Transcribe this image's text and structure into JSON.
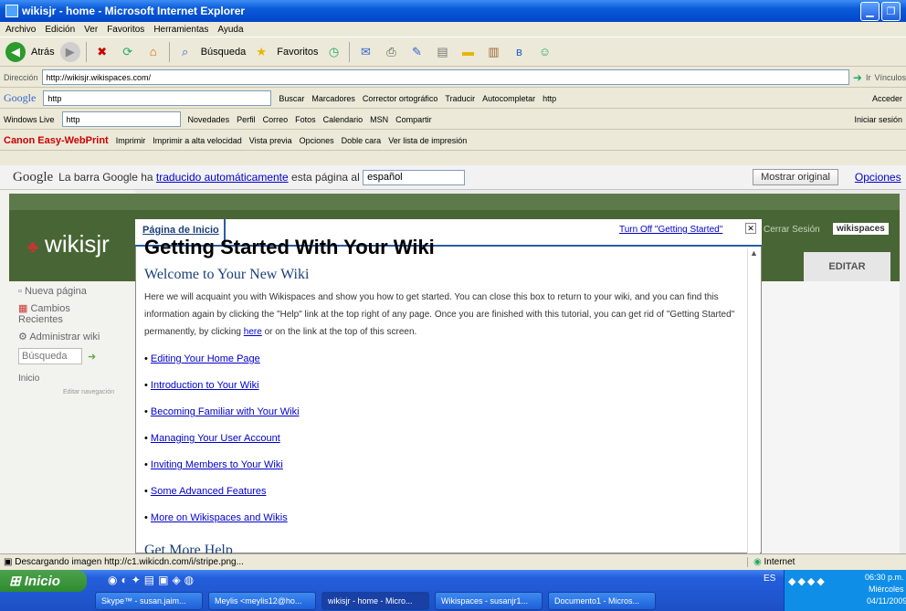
{
  "window": {
    "title": "wikisjr - home - Microsoft Internet Explorer"
  },
  "menu": [
    "Archivo",
    "Edición",
    "Ver",
    "Favoritos",
    "Herramientas",
    "Ayuda"
  ],
  "toolbar": {
    "back_label": "Atrás",
    "search_label": "Búsqueda",
    "favorites_label": "Favoritos"
  },
  "address": {
    "label": "Dirección",
    "url": "http://wikisjr.wikispaces.com/",
    "go_label": "Ir",
    "links_label": "Vínculos"
  },
  "google_toolbar": {
    "logo": "Google",
    "query": "http",
    "buscar": "Buscar",
    "marcadores": "Marcadores",
    "corrector": "Corrector ortográfico",
    "traducir": "Traducir",
    "autocompletar": "Autocompletar",
    "http": "http",
    "acceder": "Acceder"
  },
  "live_toolbar": {
    "brand": "Windows Live",
    "query": "http",
    "items": [
      "Novedades",
      "Perfil",
      "Correo",
      "Fotos",
      "Calendario",
      "MSN",
      "Compartir"
    ],
    "signin": "Iniciar sesión"
  },
  "canon_toolbar": {
    "brand": "Canon Easy-WebPrint",
    "items": [
      "Imprimir",
      "Imprimir a alta velocidad",
      "Vista previa",
      "Opciones",
      "Doble cara",
      "Ver lista de impresión"
    ]
  },
  "translate_bar": {
    "logo": "Google",
    "text_before": "La barra Google ha",
    "link": "traducido automáticamente",
    "text_after": "esta página al",
    "language": "español",
    "show_original": "Mostrar original",
    "options": "Opciones"
  },
  "site": {
    "name": "wikisjr",
    "logout": "Cerrar Sesión",
    "wikispaces": "wikispaces",
    "edit_tab": "EDITAR"
  },
  "sidebar": {
    "items": [
      "Nueva página",
      "Cambios Recientes",
      "Administrar wiki"
    ],
    "search_placeholder": "Búsqueda",
    "home": "Inicio",
    "edit_nav": "Editar navegación"
  },
  "modal": {
    "tab": "Página de Inicio",
    "turn_off": "Turn Off \"Getting Started\"",
    "title": "Getting Started With Your Wiki",
    "welcome": "Welcome to Your New Wiki",
    "intro_1": "Here we will acquaint you with Wikispaces and show you how to get started. You can close this box to return to your wiki, and you can find this information again by clicking the \"Help\" link at the top right of any page. Once you are finished with this tutorial, you can get rid of \"Getting Started\" permanently, by clicking",
    "intro_link": "here",
    "intro_2": "or on the link at the top of this screen.",
    "links": [
      "Editing Your Home Page",
      "Introduction to Your Wiki",
      "Becoming Familiar with Your Wiki",
      "Managing Your User Account",
      "Inviting Members to Your Wiki",
      "Some Advanced Features",
      "More on Wikispaces and Wikis"
    ],
    "more_help": "Get More Help"
  },
  "status": {
    "text": "Descargando imagen http://c1.wikicdn.com/i/stripe.png...",
    "zone": "Internet"
  },
  "taskbar": {
    "start": "Inicio",
    "tasks": [
      "Skype™ - susan.jaim...",
      "Meylis <meylis12@ho...",
      "wikisjr - home - Micro...",
      "Wikispaces - susanjr1...",
      "Documento1 - Micros..."
    ],
    "lang": "ES",
    "time": "06:30 p.m.",
    "day": "Miércoles",
    "date": "04/11/2009"
  }
}
